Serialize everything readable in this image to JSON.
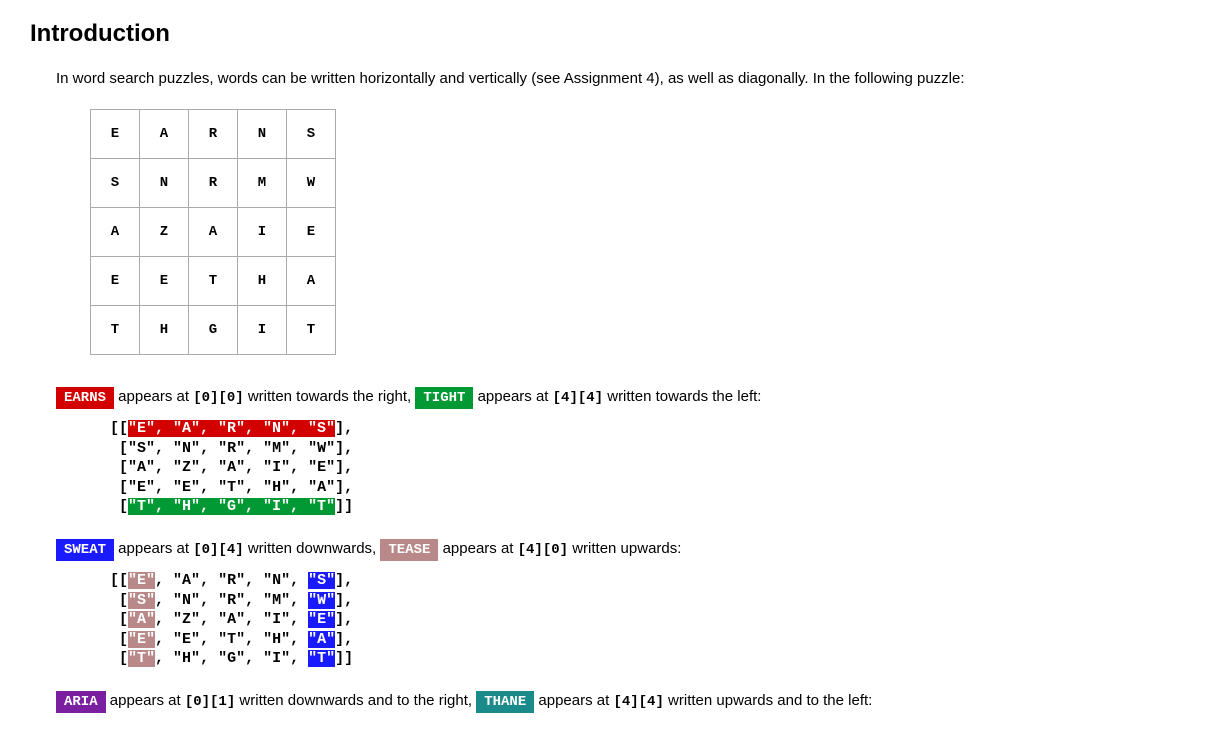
{
  "heading": "Introduction",
  "intro": "In word search puzzles, words can be written horizontally and vertically (see Assignment 4), as well as diagonally. In the following puzzle:",
  "grid": [
    [
      "E",
      "A",
      "R",
      "N",
      "S"
    ],
    [
      "S",
      "N",
      "R",
      "M",
      "W"
    ],
    [
      "A",
      "Z",
      "A",
      "I",
      "E"
    ],
    [
      "E",
      "E",
      "T",
      "H",
      "A"
    ],
    [
      "T",
      "H",
      "G",
      "I",
      "T"
    ]
  ],
  "line1": {
    "b1": " EARNS ",
    "t1": " appears at ",
    "c1": "[0][0]",
    "t2": " written towards the right, ",
    "b2": " TIGHT ",
    "t3": " appears at ",
    "c2": "[4][4]",
    "t4": " written towards the left:"
  },
  "line2": {
    "b1": " SWEAT ",
    "t1": " appears at ",
    "c1": "[0][4]",
    "t2": " written downwards, ",
    "b2": " TEASE ",
    "t3": " appears at ",
    "c2": "[4][0]",
    "t4": " written upwards:"
  },
  "line3": {
    "b1": " ARIA ",
    "t1": " appears at ",
    "c1": "[0][1]",
    "t2": " written downwards and to the right, ",
    "b2": " THANE ",
    "t3": " appears at ",
    "c2": "[4][4]",
    "t4": " written upwards and to the left:"
  },
  "q": "\"",
  "code1": {
    "row0": [
      "\"E\", \"A\", \"R\", \"N\", \"S\""
    ],
    "r1c0": "\"S\"",
    "r1c1": "\"N\"",
    "r1c2": "\"R\"",
    "r1c3": "\"M\"",
    "r1c4": "\"W\"",
    "r2c0": "\"A\"",
    "r2c1": "\"Z\"",
    "r2c2": "\"A\"",
    "r2c3": "\"I\"",
    "r2c4": "\"E\"",
    "r3c0": "\"E\"",
    "r3c1": "\"E\"",
    "r3c2": "\"T\"",
    "r3c3": "\"H\"",
    "r3c4": "\"A\"",
    "row4": [
      "\"T\", \"H\", \"G\", \"I\", \"T\""
    ]
  },
  "code2": {
    "r0c0": "\"E\"",
    "r0c1": "\"A\"",
    "r0c2": "\"R\"",
    "r0c3": "\"N\"",
    "r0c4": "\"S\"",
    "r1c0": "\"S\"",
    "r1c1": "\"N\"",
    "r1c2": "\"R\"",
    "r1c3": "\"M\"",
    "r1c4": "\"W\"",
    "r2c0": "\"A\"",
    "r2c1": "\"Z\"",
    "r2c2": "\"A\"",
    "r2c3": "\"I\"",
    "r2c4": "\"E\"",
    "r3c0": "\"E\"",
    "r3c1": "\"E\"",
    "r3c2": "\"T\"",
    "r3c3": "\"H\"",
    "r3c4": "\"A\"",
    "r4c0": "\"T\"",
    "r4c1": "\"H\"",
    "r4c2": "\"G\"",
    "r4c3": "\"I\"",
    "r4c4": "\"T\""
  }
}
